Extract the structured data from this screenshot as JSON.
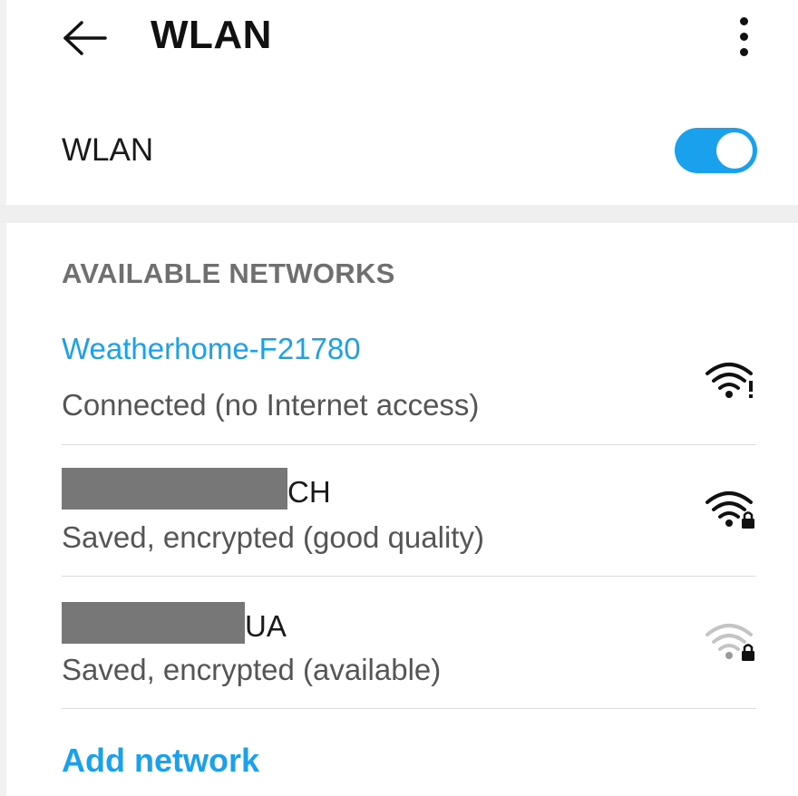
{
  "header": {
    "title": "WLAN",
    "back_icon": "arrow-left-icon",
    "more_icon": "more-vertical-icon"
  },
  "wlan_toggle": {
    "label": "WLAN",
    "enabled": true,
    "accent_color": "#1aa1ee"
  },
  "available_networks": {
    "header": "AVAILABLE NETWORKS",
    "items": [
      {
        "name": "Weatherhome-F21780",
        "status": "Connected (no Internet access)",
        "connected": true,
        "icon": "wifi-alert-icon"
      },
      {
        "name_suffix": "CH",
        "status": "Saved, encrypted (good quality)",
        "connected": false,
        "icon": "wifi-locked-icon"
      },
      {
        "name_suffix": "UA",
        "status": "Saved, encrypted (available)",
        "connected": false,
        "icon": "wifi-locked-weak-icon"
      }
    ]
  },
  "add_network": {
    "label": "Add network"
  }
}
